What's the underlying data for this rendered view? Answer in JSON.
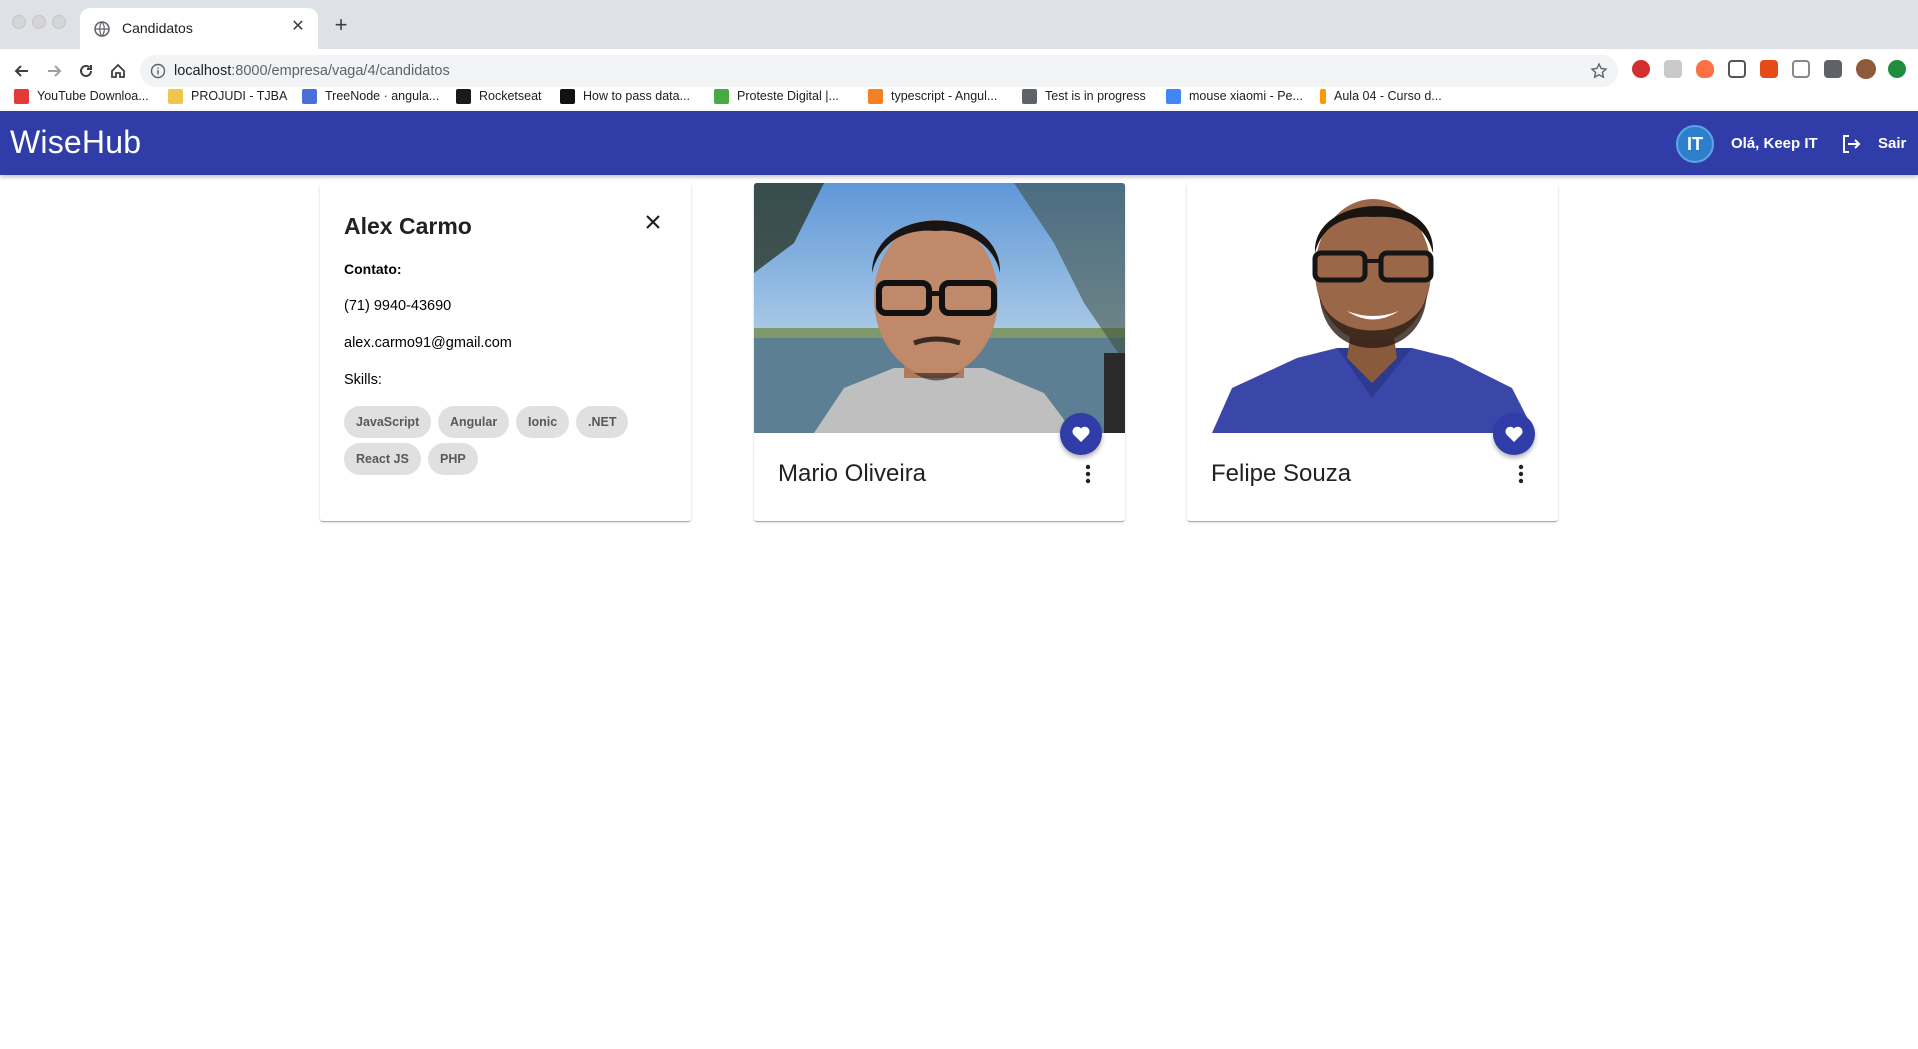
{
  "browser": {
    "tab_title": "Candidatos",
    "tab_close": "✕",
    "new_tab": "+",
    "url_host": "localhost",
    "url_path": ":8000/empresa/vaga/4/candidatos",
    "bookmarks": [
      {
        "label": "YouTube Downloa...",
        "color": "#e53935"
      },
      {
        "label": "PROJUDI - TJBA",
        "color": "#f3c44b"
      },
      {
        "label": "TreeNode · angula...",
        "color": "#4a6fd8"
      },
      {
        "label": "Rocketseat",
        "color": "#1a1a1a"
      },
      {
        "label": "How to pass data...",
        "color": "#111111"
      },
      {
        "label": "Proteste Digital |...",
        "color": "#49a942"
      },
      {
        "label": "typescript - Angul...",
        "color": "#f48024"
      },
      {
        "label": "Test is in progress",
        "color": "#5f6368"
      },
      {
        "label": "mouse xiaomi - Pe...",
        "color": "#4285f4"
      },
      {
        "label": "Aula 04 - Curso d...",
        "color": "#ff9800"
      }
    ]
  },
  "app": {
    "brand": "WiseHub",
    "avatar_text": "IT",
    "greeting": "Olá, Keep IT",
    "logout_label": "Sair",
    "accent": "#303da8"
  },
  "detail": {
    "name": "Alex Carmo",
    "contact_label": "Contato:",
    "phone": "(71) 9940-43690",
    "email": "alex.carmo91@gmail.com",
    "skills_label": "Skills:",
    "skills": [
      "JavaScript",
      "Angular",
      "Ionic",
      ".NET",
      "React JS",
      "PHP"
    ]
  },
  "candidates": [
    {
      "name": "Mario Oliveira"
    },
    {
      "name": "Felipe Souza"
    }
  ]
}
